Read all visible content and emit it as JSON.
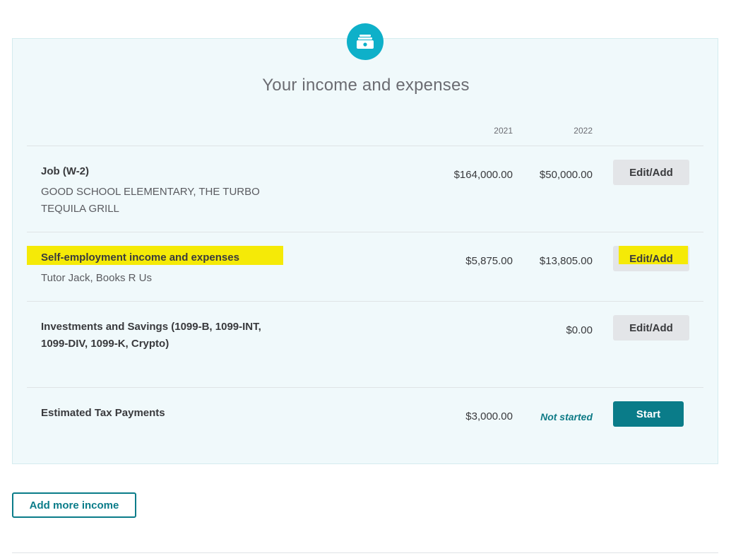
{
  "header": {
    "icon": "money-stack-icon",
    "title": "Your income and expenses"
  },
  "columns": {
    "year1": "2021",
    "year2": "2022"
  },
  "rows": [
    {
      "title": "Job (W-2)",
      "subtitle_lines": [
        "GOOD SCHOOL ELEMENTARY, THE TURBO",
        "TEQUILA GRILL"
      ],
      "amount_2021": "$164,000.00",
      "amount_2022": "$50,000.00",
      "button_label": "Edit/Add"
    },
    {
      "title": "Self-employment income and expenses",
      "subtitle_lines": [
        "Tutor Jack, Books R Us"
      ],
      "amount_2021": "$5,875.00",
      "amount_2022": "$13,805.00",
      "button_label": "Edit/Add",
      "highlighted": true
    },
    {
      "title_lines": [
        "Investments and Savings (1099-B, 1099-INT,",
        "1099-DIV, 1099-K, Crypto)"
      ],
      "amount_2021": "",
      "amount_2022": "$0.00",
      "button_label": "Edit/Add"
    },
    {
      "title": "Estimated Tax Payments",
      "amount_2021": "$3,000.00",
      "amount_2022": "Not started",
      "button_label": "Start"
    }
  ],
  "footer": {
    "add_more_label": "Add more income"
  },
  "colors": {
    "accent": "#0a7c89",
    "badge": "#0eb0c9",
    "panel_bg": "#f0f9fb",
    "highlight": "#f5ea07"
  }
}
